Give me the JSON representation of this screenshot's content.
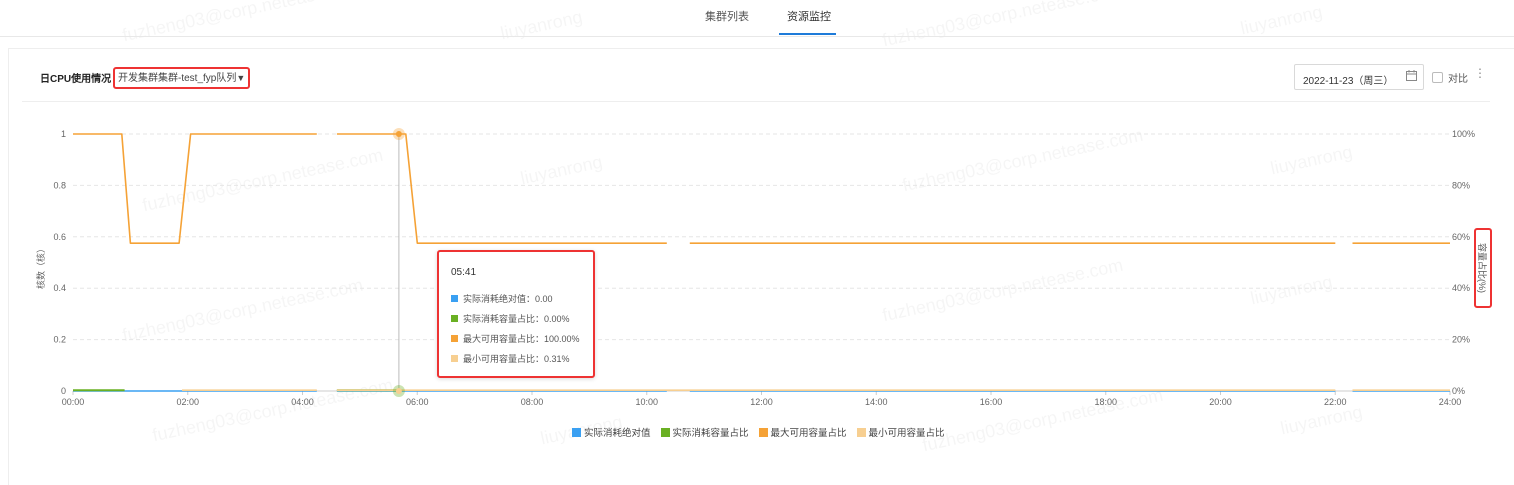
{
  "tabs": [
    {
      "label": "集群列表",
      "active": false
    },
    {
      "label": "资源监控",
      "active": true
    }
  ],
  "panel": {
    "title": "日CPU使用情况",
    "filter_label": "开发集群集群-test_fyp队列",
    "date_value": "2022-11-23（周三）",
    "compare_label": "对比",
    "more_icon": "more-vertical-icon"
  },
  "colors": {
    "accent": "#1e7bd9",
    "highlight_border": "#e33333",
    "series_abs": "#3aa0f2",
    "series_used_pct": "#6ab023",
    "series_max_pct": "#f5a236",
    "series_min_pct": "#f7cf91"
  },
  "watermark": {
    "lines": [
      "fuzheng03@corp.netease.com",
      "liuyanrong"
    ]
  },
  "chart_data": {
    "type": "line",
    "ylabel": "核数（核）",
    "ylabel_right": "容量占比(%)",
    "x_ticks": [
      "00:00",
      "02:00",
      "04:00",
      "06:00",
      "08:00",
      "10:00",
      "12:00",
      "14:00",
      "16:00",
      "18:00",
      "20:00",
      "22:00",
      "24:00"
    ],
    "xlim": [
      0,
      24
    ],
    "ylim": [
      0,
      1
    ],
    "y_ticks": [
      "0",
      "0.2",
      "0.4",
      "0.6",
      "0.8",
      "1"
    ],
    "ylim_right": [
      0,
      100
    ],
    "y_ticks_right": [
      "0%",
      "20%",
      "40%",
      "60%",
      "80%",
      "100%"
    ],
    "grid": true,
    "legend_position": "bottom",
    "series": [
      {
        "name": "实际消耗绝对值",
        "color": "#3aa0f2",
        "segments": [
          [
            [
              0,
              0
            ],
            [
              4.25,
              0
            ]
          ],
          [
            [
              4.6,
              0
            ],
            [
              10.35,
              0
            ]
          ],
          [
            [
              10.75,
              0
            ],
            [
              22.0,
              0
            ]
          ],
          [
            [
              22.3,
              0
            ],
            [
              24,
              0
            ]
          ]
        ]
      },
      {
        "name": "实际消耗容量占比",
        "color": "#6ab023",
        "segments": [
          [
            [
              0,
              0.003
            ],
            [
              0.9,
              0.003
            ]
          ],
          [
            [
              4.6,
              0.003
            ],
            [
              5.7,
              0.003
            ]
          ]
        ]
      },
      {
        "name": "最大可用容量占比",
        "color": "#f5a236",
        "segments": [
          [
            [
              0,
              1
            ],
            [
              0.85,
              1
            ],
            [
              1.0,
              0.575
            ],
            [
              1.85,
              0.575
            ],
            [
              2.05,
              1
            ],
            [
              4.25,
              1
            ]
          ],
          [
            [
              4.6,
              1
            ],
            [
              5.8,
              1
            ],
            [
              6.0,
              0.575
            ],
            [
              10.35,
              0.575
            ]
          ],
          [
            [
              10.75,
              0.575
            ],
            [
              22.0,
              0.575
            ]
          ],
          [
            [
              22.3,
              0.575
            ],
            [
              24,
              0.575
            ]
          ]
        ]
      },
      {
        "name": "最小可用容量占比",
        "color": "#f7cf91",
        "segments": [
          [
            [
              1.9,
              0.003
            ],
            [
              4.25,
              0.003
            ]
          ],
          [
            [
              4.6,
              0.003
            ],
            [
              22.0,
              0.003
            ]
          ],
          [
            [
              22.3,
              0.003
            ],
            [
              24,
              0.003
            ]
          ]
        ]
      }
    ],
    "crosshair_x": 5.68,
    "tooltip": {
      "time": "05:41",
      "rows": [
        {
          "label": "实际消耗绝对值：",
          "value": "0.00",
          "color": "#3aa0f2"
        },
        {
          "label": "实际消耗容量占比：",
          "value": "0.00%",
          "color": "#6ab023"
        },
        {
          "label": "最大可用容量占比：",
          "value": "100.00%",
          "color": "#f5a236"
        },
        {
          "label": "最小可用容量占比：",
          "value": "0.31%",
          "color": "#f7cf91"
        }
      ]
    }
  }
}
